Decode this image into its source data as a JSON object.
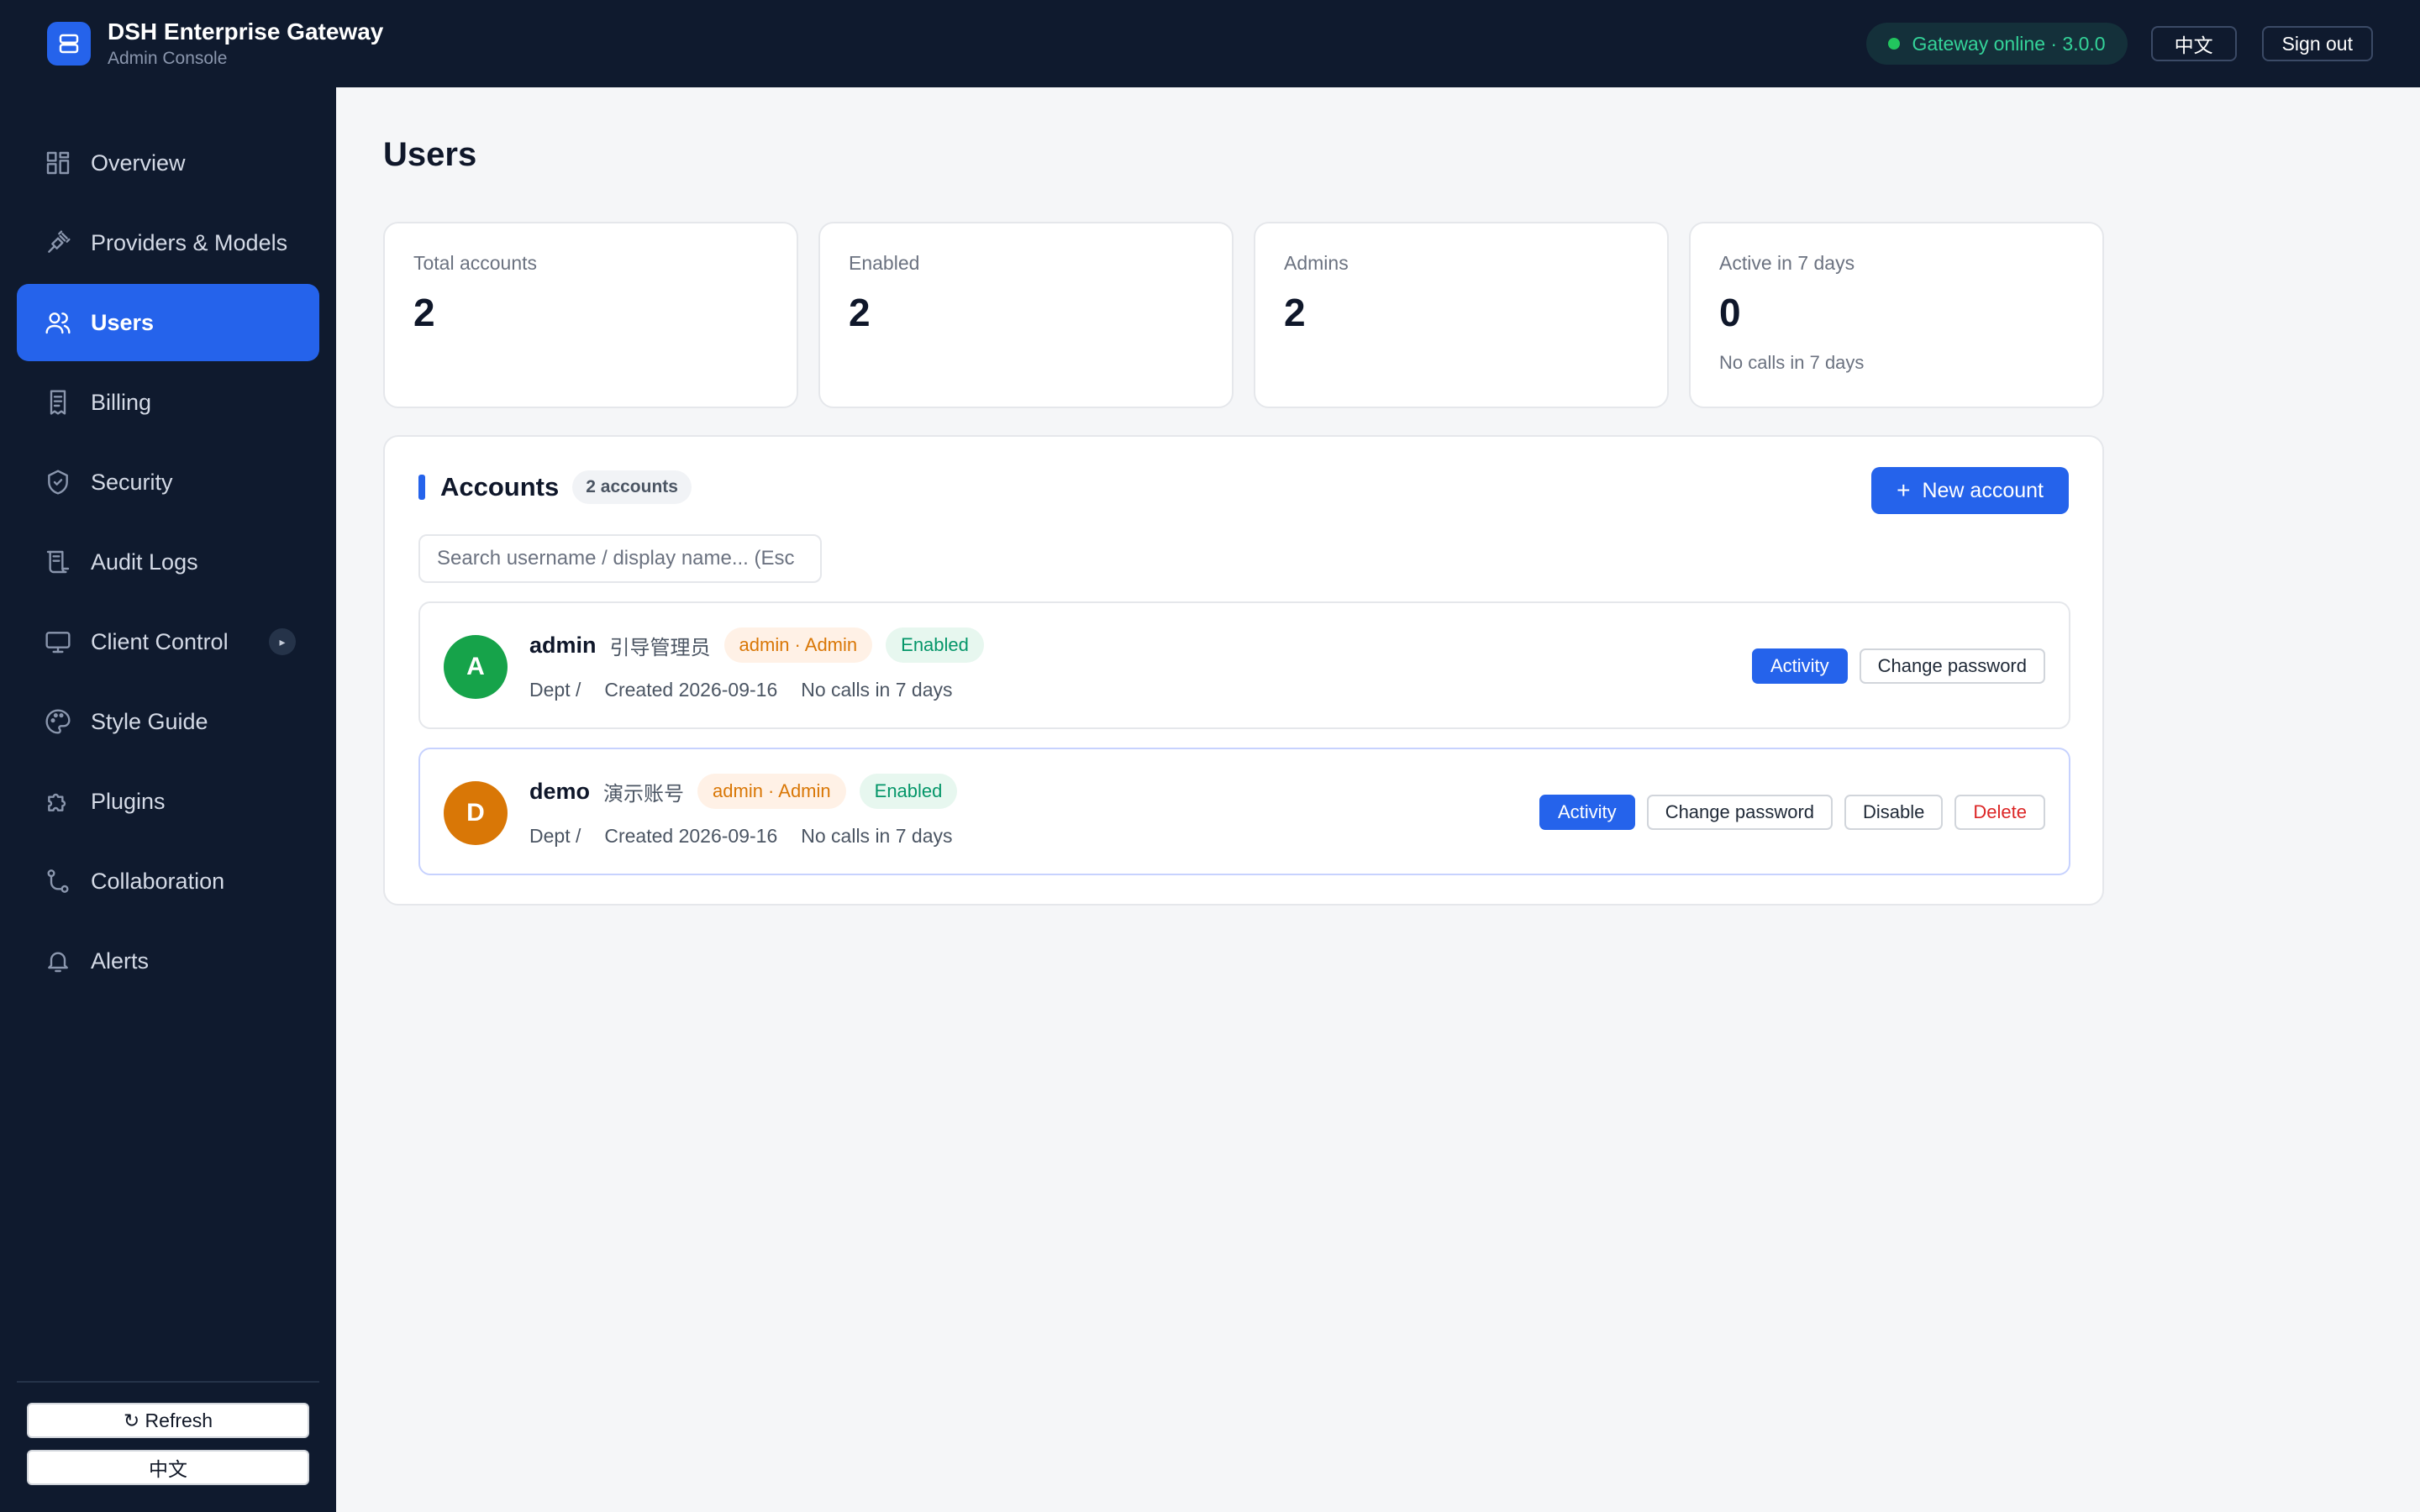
{
  "app": {
    "title": "DSH Enterprise Gateway",
    "subtitle": "Admin Console",
    "logo_icon": "server-icon"
  },
  "header": {
    "status_text": "Gateway online · 3.0.0",
    "status_color": "#34d399",
    "lang_label": "中文",
    "signout_label": "Sign out"
  },
  "sidebar": {
    "items": [
      {
        "label": "Overview",
        "icon": "grid-icon",
        "active": false
      },
      {
        "label": "Providers & Models",
        "icon": "plug-icon",
        "active": false
      },
      {
        "label": "Users",
        "icon": "users-icon",
        "active": true
      },
      {
        "label": "Billing",
        "icon": "receipt-icon",
        "active": false
      },
      {
        "label": "Security",
        "icon": "shield-icon",
        "active": false
      },
      {
        "label": "Audit Logs",
        "icon": "scroll-icon",
        "active": false
      },
      {
        "label": "Client Control",
        "icon": "monitor-icon",
        "active": false,
        "caret": "▸"
      },
      {
        "label": "Style Guide",
        "icon": "palette-icon",
        "active": false
      },
      {
        "label": "Plugins",
        "icon": "puzzle-icon",
        "active": false
      },
      {
        "label": "Collaboration",
        "icon": "git-branch-icon",
        "active": false
      },
      {
        "label": "Alerts",
        "icon": "bell-icon",
        "active": false
      }
    ],
    "refresh_label": "↻ Refresh",
    "lang_label": "中文"
  },
  "page": {
    "title": "Users"
  },
  "stats": [
    {
      "label": "Total accounts",
      "value": "2",
      "note": ""
    },
    {
      "label": "Enabled",
      "value": "2",
      "note": ""
    },
    {
      "label": "Admins",
      "value": "2",
      "note": ""
    },
    {
      "label": "Active in 7 days",
      "value": "0",
      "note": "No calls in 7 days"
    }
  ],
  "accounts": {
    "title": "Accounts",
    "count_badge": "2 accounts",
    "new_button_icon": "+",
    "new_button_label": "New account",
    "search_placeholder": "Search username / display name... (Esc",
    "search_value": "",
    "rows": [
      {
        "initial": "A",
        "avatar_color": "#16a34a",
        "username": "admin",
        "display_name": "引导管理员",
        "role": "admin · Admin",
        "status": "Enabled",
        "dept": "Dept /",
        "created": "Created 2026-09-16",
        "activity_note": "No calls in 7 days",
        "actions": [
          "Activity",
          "Change password"
        ]
      },
      {
        "initial": "D",
        "avatar_color": "#d97706",
        "username": "demo",
        "display_name": "演示账号",
        "role": "admin · Admin",
        "status": "Enabled",
        "dept": "Dept /",
        "created": "Created 2026-09-16",
        "activity_note": "No calls in 7 days",
        "actions": [
          "Activity",
          "Change password",
          "Disable",
          "Delete"
        ]
      }
    ]
  }
}
